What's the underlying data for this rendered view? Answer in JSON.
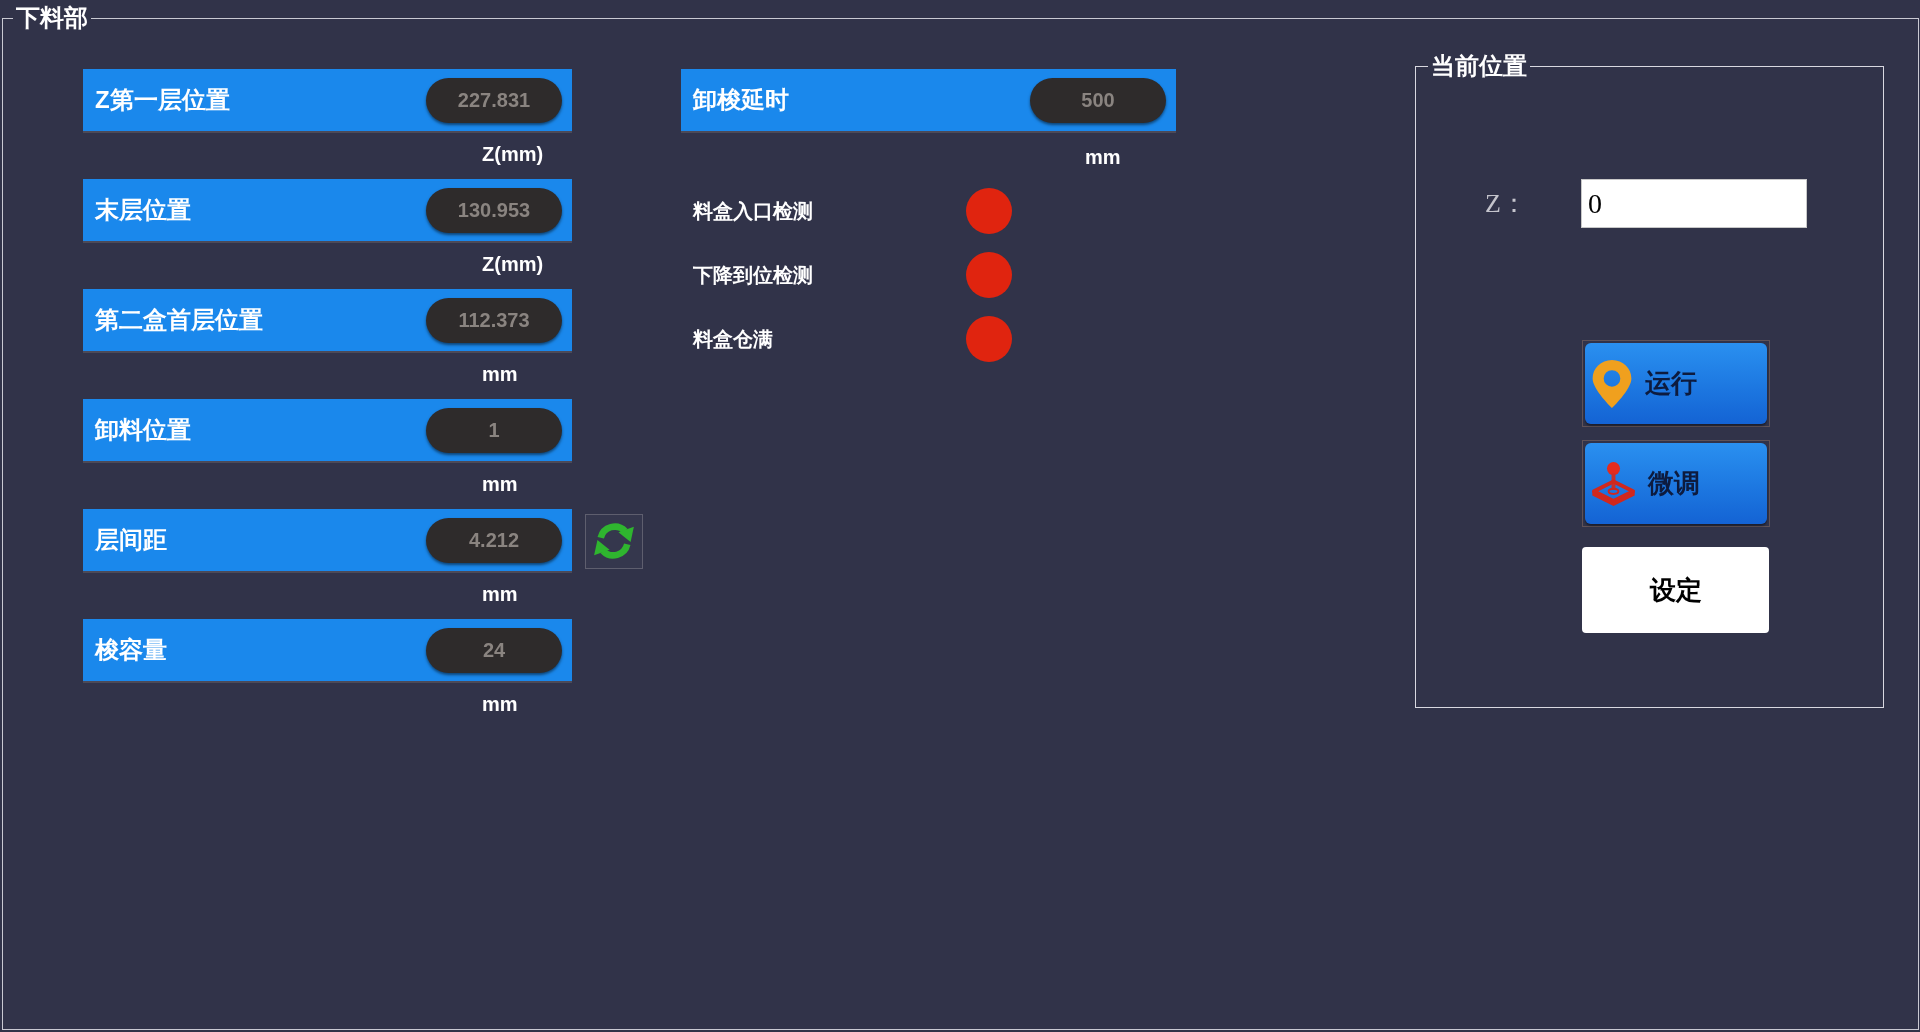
{
  "panel_title": "下料部",
  "parameters": [
    {
      "label": "Z第一层位置",
      "value": "227.831",
      "unit": "Z(mm)",
      "refresh": false
    },
    {
      "label": "末层位置",
      "value": "130.953",
      "unit": "Z(mm)",
      "refresh": false
    },
    {
      "label": "第二盒首层位置",
      "value": "112.373",
      "unit": "mm",
      "refresh": false
    },
    {
      "label": "卸料位置",
      "value": "1",
      "unit": "mm",
      "refresh": false
    },
    {
      "label": "层间距",
      "value": "4.212",
      "unit": "mm",
      "refresh": true
    },
    {
      "label": "梭容量",
      "value": "24",
      "unit": "mm",
      "refresh": false
    }
  ],
  "delay": {
    "label": "卸梭延时",
    "value": "500",
    "unit": "mm"
  },
  "sensors": [
    {
      "label": "料盒入口检测",
      "color": "#e0240f"
    },
    {
      "label": "下降到位检测",
      "color": "#e0240f"
    },
    {
      "label": "料盒仓满",
      "color": "#e0240f"
    }
  ],
  "current_position": {
    "title": "当前位置",
    "axis_label": "Z：",
    "value": "0",
    "buttons": [
      {
        "label": "运行",
        "kind": "run"
      },
      {
        "label": "微调",
        "kind": "jog"
      },
      {
        "label": "设定",
        "kind": "set"
      }
    ]
  }
}
